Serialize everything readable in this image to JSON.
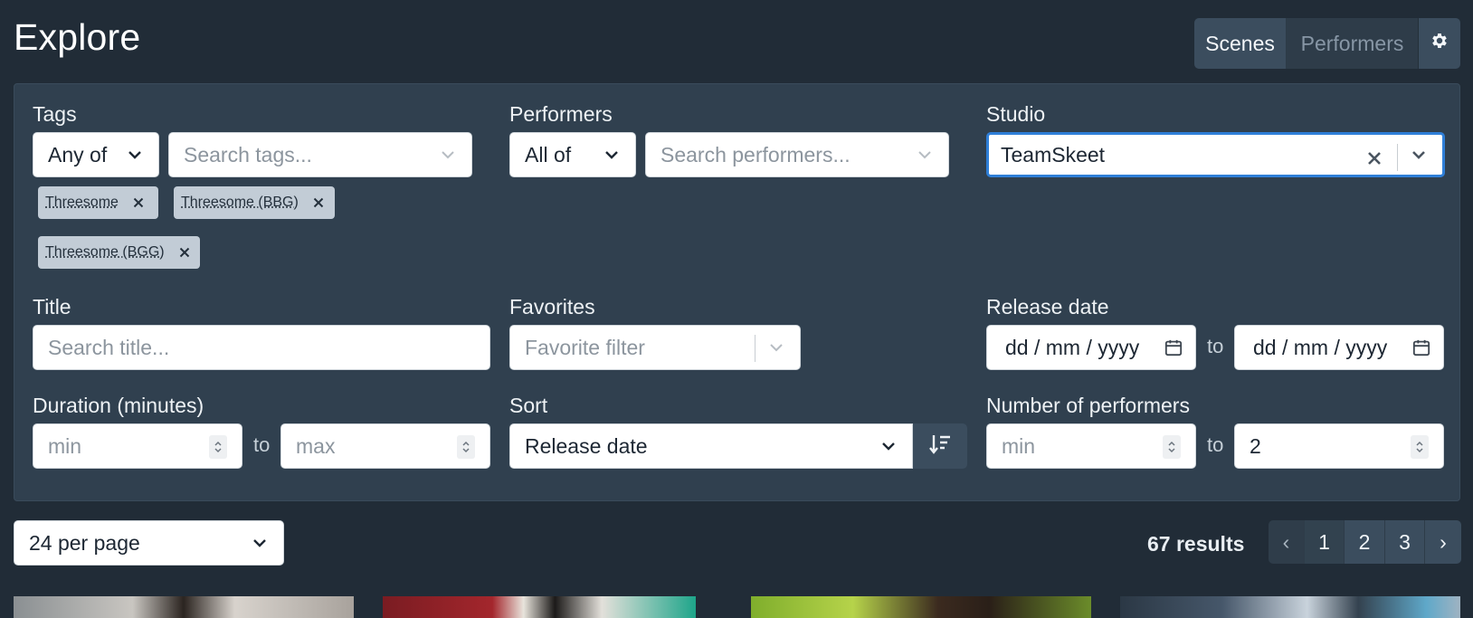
{
  "header": {
    "title": "Explore",
    "modes": [
      "Scenes",
      "Performers"
    ],
    "active_mode": "Scenes",
    "settings_icon": "gear-icon"
  },
  "filters": {
    "tags": {
      "label": "Tags",
      "mode": "Any of",
      "placeholder": "Search tags...",
      "selected": [
        "Threesome",
        "Threesome (BBG)",
        "Threesome (BGG)"
      ]
    },
    "performers": {
      "label": "Performers",
      "mode": "All of",
      "placeholder": "Search performers..."
    },
    "studio": {
      "label": "Studio",
      "value": "TeamSkeet"
    },
    "title": {
      "label": "Title",
      "placeholder": "Search title..."
    },
    "favorites": {
      "label": "Favorites",
      "placeholder": "Favorite filter"
    },
    "release_date": {
      "label": "Release date",
      "from_placeholder": "dd / mm / yyyy",
      "to_placeholder": "dd / mm / yyyy",
      "to_text": "to"
    },
    "duration": {
      "label": "Duration (minutes)",
      "min_placeholder": "min",
      "max_placeholder": "max",
      "to_text": "to"
    },
    "sort": {
      "label": "Sort",
      "value": "Release date"
    },
    "num_performers": {
      "label": "Number of performers",
      "min_placeholder": "min",
      "max_value": "2",
      "to_text": "to"
    }
  },
  "results": {
    "per_page": "24 per page",
    "count_text": "67 results",
    "pages": [
      "1",
      "2",
      "3"
    ],
    "current_page": "2",
    "prev": "‹",
    "next": "›"
  },
  "colors": {
    "background": "#212c37",
    "panel": "#30404f",
    "accent_focus": "#2f7fd8",
    "chip": "#c2ccd6"
  }
}
